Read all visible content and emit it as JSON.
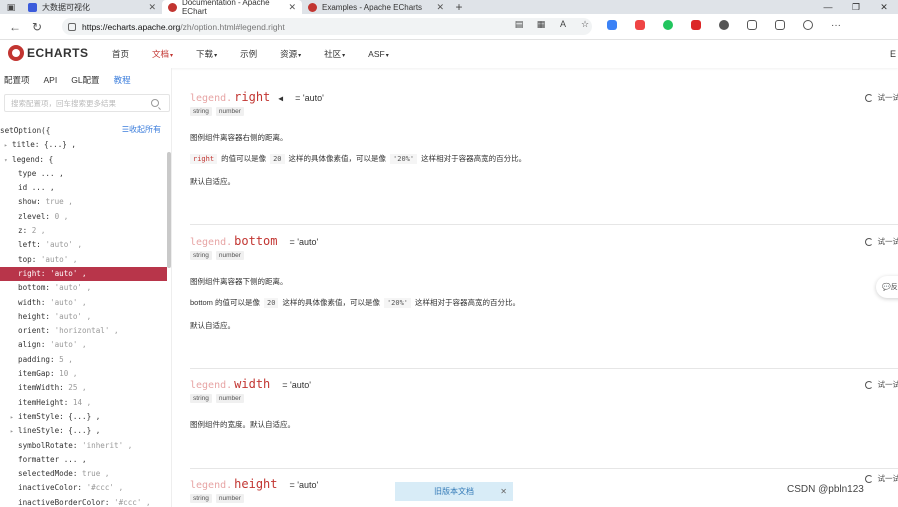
{
  "browser": {
    "tabs": [
      {
        "title": "大数据可视化",
        "active": false,
        "fav_color": "#3b5bdb"
      },
      {
        "title": "Documentation - Apache EChart",
        "active": true,
        "fav_color": "#c23531"
      },
      {
        "title": "Examples - Apache ECharts",
        "active": false,
        "fav_color": "#c23531"
      }
    ],
    "url_host": "https://echarts.apache.org",
    "url_path": "/zh/option.html#legend.right"
  },
  "site": {
    "logo": "ECHARTS",
    "nav": [
      "首页",
      "文档",
      "下载",
      "示例",
      "资源",
      "社区",
      "ASF"
    ],
    "edge_text": "E"
  },
  "sidebar": {
    "tabs": [
      "配置项",
      "API",
      "GL配置",
      "教程"
    ],
    "search_placeholder": "搜索配置项，回车搜索更多结果",
    "collapse_all": "收起所有",
    "tree": [
      {
        "key": "setOption({",
        "val": "",
        "indent": 0,
        "arrow": ""
      },
      {
        "key": "title: {...} ,",
        "val": "",
        "indent": 1,
        "arrow": "▸"
      },
      {
        "key": "legend: {",
        "val": "",
        "indent": 1,
        "arrow": "▾"
      },
      {
        "key": "type ... ,",
        "val": "",
        "indent": 2,
        "arrow": ""
      },
      {
        "key": "id ... ,",
        "val": "",
        "indent": 2,
        "arrow": ""
      },
      {
        "key": "show: ",
        "val": "true ,",
        "indent": 2,
        "arrow": ""
      },
      {
        "key": "zlevel: ",
        "val": "0 ,",
        "indent": 2,
        "arrow": ""
      },
      {
        "key": "z: ",
        "val": "2 ,",
        "indent": 2,
        "arrow": ""
      },
      {
        "key": "left: ",
        "val": "'auto' ,",
        "indent": 2,
        "arrow": ""
      },
      {
        "key": "top: ",
        "val": "'auto' ,",
        "indent": 2,
        "arrow": ""
      },
      {
        "key": "right: ",
        "val": "'auto' ,",
        "indent": 2,
        "arrow": "",
        "active": true
      },
      {
        "key": "bottom: ",
        "val": "'auto' ,",
        "indent": 2,
        "arrow": ""
      },
      {
        "key": "width: ",
        "val": "'auto' ,",
        "indent": 2,
        "arrow": ""
      },
      {
        "key": "height: ",
        "val": "'auto' ,",
        "indent": 2,
        "arrow": ""
      },
      {
        "key": "orient: ",
        "val": "'horizontal' ,",
        "indent": 2,
        "arrow": ""
      },
      {
        "key": "align: ",
        "val": "'auto' ,",
        "indent": 2,
        "arrow": ""
      },
      {
        "key": "padding: ",
        "val": "5 ,",
        "indent": 2,
        "arrow": ""
      },
      {
        "key": "itemGap: ",
        "val": "10 ,",
        "indent": 2,
        "arrow": ""
      },
      {
        "key": "itemWidth: ",
        "val": "25 ,",
        "indent": 2,
        "arrow": ""
      },
      {
        "key": "itemHeight: ",
        "val": "14 ,",
        "indent": 2,
        "arrow": ""
      },
      {
        "key": "itemStyle: {...} ,",
        "val": "",
        "indent": 2,
        "arrow": "▸"
      },
      {
        "key": "lineStyle: {...} ,",
        "val": "",
        "indent": 2,
        "arrow": "▸"
      },
      {
        "key": "symbolRotate: ",
        "val": "'inherit' ,",
        "indent": 2,
        "arrow": ""
      },
      {
        "key": "formatter ... ,",
        "val": "",
        "indent": 2,
        "arrow": ""
      },
      {
        "key": "selectedMode: ",
        "val": "true ,",
        "indent": 2,
        "arrow": ""
      },
      {
        "key": "inactiveColor: ",
        "val": "'#ccc' ,",
        "indent": 2,
        "arrow": ""
      },
      {
        "key": "inactiveBorderColor: ",
        "val": "'#ccc' ,",
        "indent": 2,
        "arrow": ""
      }
    ]
  },
  "content": {
    "try_label": "试一试",
    "sections": [
      {
        "prefix": "legend.",
        "name": "right",
        "eq": "= 'auto'",
        "tags": [
          "string",
          "number"
        ],
        "desc": "图例组件离容器右侧的距离。",
        "detail_before": "",
        "detail_code1": "right",
        "detail_mid": "的值可以是像",
        "detail_code2": "20",
        "detail_mid2": "这样的具体像素值，可以是像",
        "detail_code3": "'20%'",
        "detail_after": "这样相对于容器高宽的百分比。",
        "default": "默认自适应。",
        "has_triangle": true
      },
      {
        "prefix": "legend.",
        "name": "bottom",
        "eq": "= 'auto'",
        "tags": [
          "string",
          "number"
        ],
        "desc": "图例组件离容器下侧的距离。",
        "detail_before": "bottom 的值可以是像",
        "detail_code2": "20",
        "detail_mid2": "这样的具体像素值，可以是像",
        "detail_code3": "'20%'",
        "detail_after": "这样相对于容器高宽的百分比。",
        "default": "默认自适应。"
      },
      {
        "prefix": "legend.",
        "name": "width",
        "eq": "= 'auto'",
        "tags": [
          "string",
          "number"
        ],
        "desc": "图例组件的宽度。默认自适应。"
      },
      {
        "prefix": "legend.",
        "name": "height",
        "eq": "= 'auto'",
        "tags": [
          "string",
          "number"
        ]
      }
    ],
    "float_btn": "反",
    "old_version": "旧版本文档",
    "watermark": "CSDN @pbln123"
  }
}
